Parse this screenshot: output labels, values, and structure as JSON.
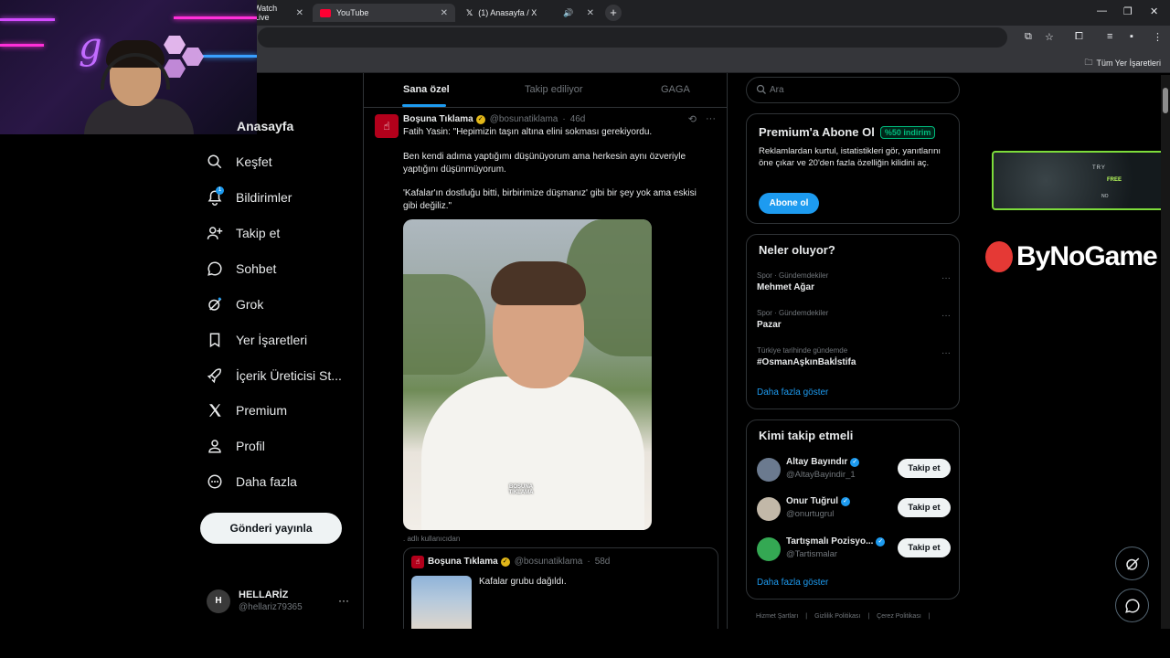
{
  "browser": {
    "tabs": [
      {
        "label": "Watch Live",
        "favicon": "live-icon"
      },
      {
        "label": "YouTube",
        "favicon": "youtube-icon"
      },
      {
        "label": "(1) Anasayfa / X",
        "favicon": "x-icon"
      }
    ],
    "bookmarks_label": "Tüm Yer İşaretleri"
  },
  "nav": {
    "home": "Anasayfa",
    "items": [
      {
        "label": "Keşfet",
        "icon": "search-icon"
      },
      {
        "label": "Bildirimler",
        "icon": "bell-icon",
        "badge": "1"
      },
      {
        "label": "Takip et",
        "icon": "add-user-icon"
      },
      {
        "label": "Sohbet",
        "icon": "chat-icon"
      },
      {
        "label": "Grok",
        "icon": "grok-icon"
      },
      {
        "label": "Yer İşaretleri",
        "icon": "bookmark-icon"
      },
      {
        "label": "İçerik Üreticisi St...",
        "icon": "rocket-icon"
      },
      {
        "label": "Premium",
        "icon": "x-logo-icon"
      },
      {
        "label": "Profil",
        "icon": "person-icon"
      },
      {
        "label": "Daha fazla",
        "icon": "more-circle-icon"
      }
    ],
    "post_button": "Gönderi yayınla",
    "account": {
      "initial": "H",
      "name": "HELLARİZ",
      "handle": "@hellariz79365",
      "menu": "···"
    }
  },
  "timeline": {
    "tabs": [
      "Sana özel",
      "Takip ediliyor",
      "GAGA"
    ],
    "tweet": {
      "name": "Boşuna Tıklama",
      "handle": "@bosunatiklama",
      "age": "46d",
      "lines": [
        "Fatih Yasin: \"Hepimizin taşın altına elini sokması gerekiyordu.",
        "Ben kendi adıma yaptığımı düşünüyorum ama herkesin aynı özveriyle",
        "yaptığını düşünmüyorum.",
        "'Kafalar'ın dostluğu bitti, birbirimize düşmanız' gibi bir şey yok ama eskisi",
        "gibi değiliz.\""
      ],
      "media_logo": "BOŞUNA TIKLAMA",
      "source": ". adlı kullanıcıdan"
    },
    "quoted": {
      "name": "Boşuna Tıklama",
      "handle": "@bosunatiklama",
      "age": "58d",
      "text": "Kafalar grubu dağıldı."
    }
  },
  "sidebar": {
    "search_placeholder": "Ara",
    "premium": {
      "title": "Premium'a Abone Ol",
      "discount": "%50 indirim",
      "text": "Reklamlardan kurtul, istatistikleri gör, yanıtlarını öne çıkar ve 20'den fazla özelliğin kilidini aç.",
      "button": "Abone ol"
    },
    "trends": {
      "title": "Neler oluyor?",
      "items": [
        {
          "category": "Spor · Gündemdekiler",
          "name": "Mehmet Ağar"
        },
        {
          "category": "Spor · Gündemdekiler",
          "name": "Pazar"
        },
        {
          "category": "Türkiye tarihinde gündemde",
          "name": "#OsmanAşkınBakİstifa"
        }
      ],
      "show_more": "Daha fazla göster"
    },
    "who_to_follow": {
      "title": "Kimi takip etmeli",
      "items": [
        {
          "name": "Altay Bayındır",
          "handle": "@AltayBayindir_1",
          "button": "Takip et",
          "avatar_color": "#6b7a8f"
        },
        {
          "name": "Onur Tuğrul",
          "handle": "@onurtugrul",
          "button": "Takip et",
          "avatar_color": "#c2b8a8"
        },
        {
          "name": "Tartışmalı Pozisyo...",
          "handle": "@Tartismalar",
          "button": "Takip et",
          "avatar_color": "#34a853"
        }
      ],
      "show_more": "Daha fazla göster"
    },
    "footer": [
      "Hizmet Şartları",
      "|",
      "Gizlilik Politikası",
      "|",
      "Çerez Politikası",
      "|"
    ]
  },
  "overlays": {
    "ad_try": "TRY",
    "ad_free": "FREE",
    "ad_no": "NO",
    "brand": "ByNoGame"
  }
}
